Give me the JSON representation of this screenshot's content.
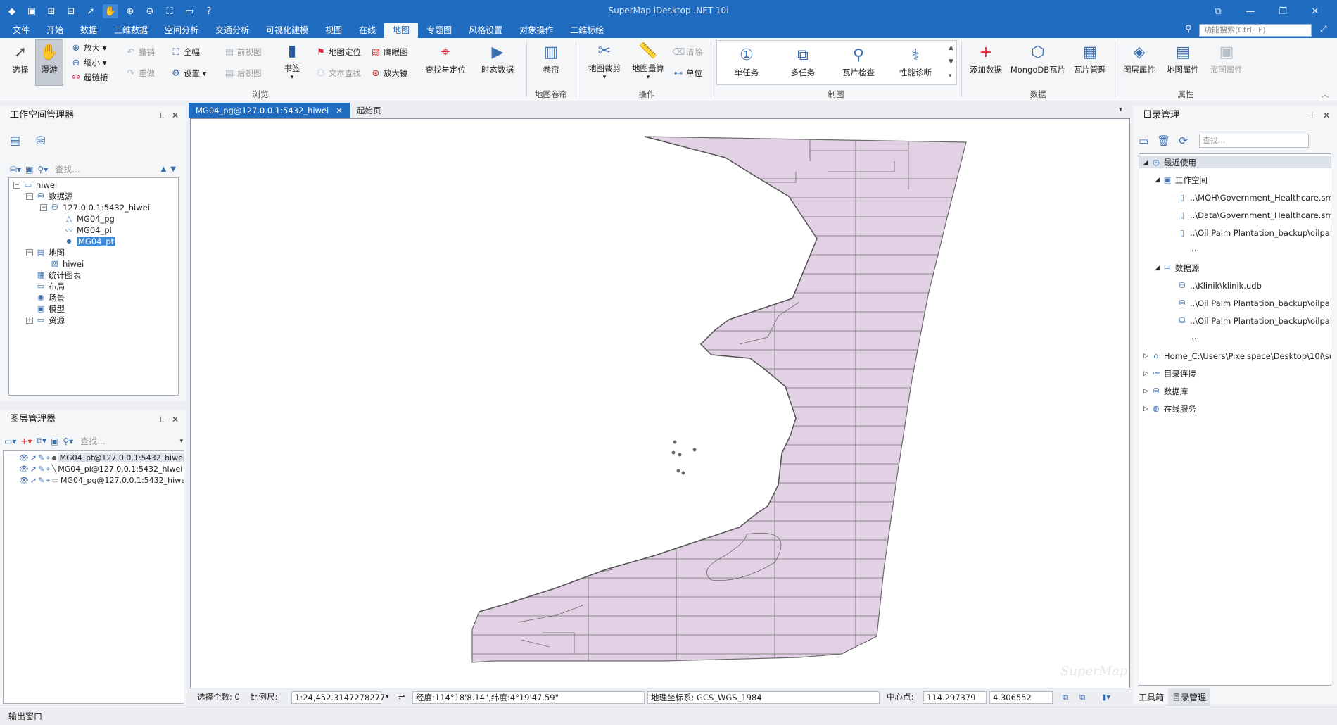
{
  "app": {
    "title": "SuperMap iDesktop .NET 10i"
  },
  "menus": [
    "文件",
    "开始",
    "数据",
    "三维数据",
    "空间分析",
    "交通分析",
    "可视化建模",
    "视图",
    "在线",
    "地图",
    "专题图",
    "风格设置",
    "对象操作",
    "二维标绘"
  ],
  "active_menu_index": 9,
  "function_search_placeholder": "功能搜索(Ctrl+F)",
  "ribbon": {
    "browse": {
      "select": "选择",
      "pan": "漫游",
      "zoom_in": "放大",
      "zoom_out": "缩小",
      "hyperlink": "超链接",
      "undo": "撤销",
      "redo": "重做",
      "full_extent": "全幅",
      "settings": "设置",
      "prev_view": "前视图",
      "next_view": "后视图",
      "bookmark": "书签",
      "map_locate": "地图定位",
      "text_find": "文本查找",
      "eagle_eye": "鹰眼图",
      "magnifier": "放大镜",
      "find_locate": "查找与定位",
      "dynamic_data": "时态数据",
      "group_label": "浏览"
    },
    "roller": {
      "roller": "卷帘",
      "group_label": "地图卷帘"
    },
    "operation": {
      "map_clip": "地图裁剪",
      "map_measure": "地图量算",
      "clear": "清除",
      "unit": "单位",
      "group_label": "操作"
    },
    "drawing": {
      "single_task": "单任务",
      "multi_task": "多任务",
      "tile_check": "瓦片检查",
      "perf_diag": "性能诊断",
      "group_label": "制图"
    },
    "data": {
      "add_data": "添加数据",
      "mongodb_tile": "MongoDB瓦片",
      "tile_manage": "瓦片管理",
      "group_label": "数据"
    },
    "properties": {
      "layer_props": "图层属性",
      "map_props": "地图属性",
      "chart_props": "海图属性",
      "group_label": "属性"
    }
  },
  "workspace_manager": {
    "title": "工作空间管理器",
    "search_placeholder": "查找...",
    "tree": {
      "root": "hiwei",
      "datasources": "数据源",
      "connection": "127.0.0.1:5432_hiwei",
      "datasets": [
        "MG04_pg",
        "MG04_pl",
        "MG04_pt"
      ],
      "maps": "地图",
      "map_item": "hiwei",
      "charts": "统计图表",
      "layouts": "布局",
      "scenes": "场景",
      "models": "模型",
      "resources": "资源"
    }
  },
  "layer_manager": {
    "title": "图层管理器",
    "search_placeholder": "查找...",
    "layers": [
      "MG04_pt@127.0.0.1:5432_hiwei",
      "MG04_pl@127.0.0.1:5432_hiwei",
      "MG04_pg@127.0.0.1:5432_hiwei"
    ]
  },
  "doc_tabs": [
    "MG04_pg@127.0.0.1:5432_hiwei",
    "起始页"
  ],
  "map": {
    "watermark": "SuperMap",
    "fill_color": "#e2d1e4",
    "stroke_color": "#6b6b6b"
  },
  "status": {
    "selected_count": "选择个数: 0",
    "scale_label": "比例尺:",
    "scale_value": "1:24,452.3147278277",
    "lonlat": "经度:114°18'8.14\",纬度:4°19'47.59\"",
    "crs": "地理坐标系: GCS_WGS_1984",
    "center_label": "中心点:",
    "center_x": "114.297379",
    "center_y": "4.306552"
  },
  "catalog": {
    "title": "目录管理",
    "search_placeholder": "查找...",
    "recent": "最近使用",
    "workspaces": "工作空间",
    "workspace_items": [
      "..\\MOH\\Government_Healthcare.smwu",
      "..\\Data\\Government_Healthcare.smwu",
      "..\\Oil Palm Plantation_backup\\oilpal..."
    ],
    "ellipsis": "...",
    "datasources": "数据源",
    "datasource_items": [
      "..\\Klinik\\klinik.udb",
      "..\\Oil Palm Plantation_backup\\oilpal...",
      "..\\Oil Palm Plantation_backup\\oilpal..."
    ],
    "home": "Home_C:\\Users\\Pixelspace\\Desktop\\10i\\su...",
    "dir_links": "目录连接",
    "databases": "数据库",
    "online": "在线服务"
  },
  "right_tabs": [
    "工具箱",
    "目录管理"
  ],
  "output_window": "输出窗口"
}
